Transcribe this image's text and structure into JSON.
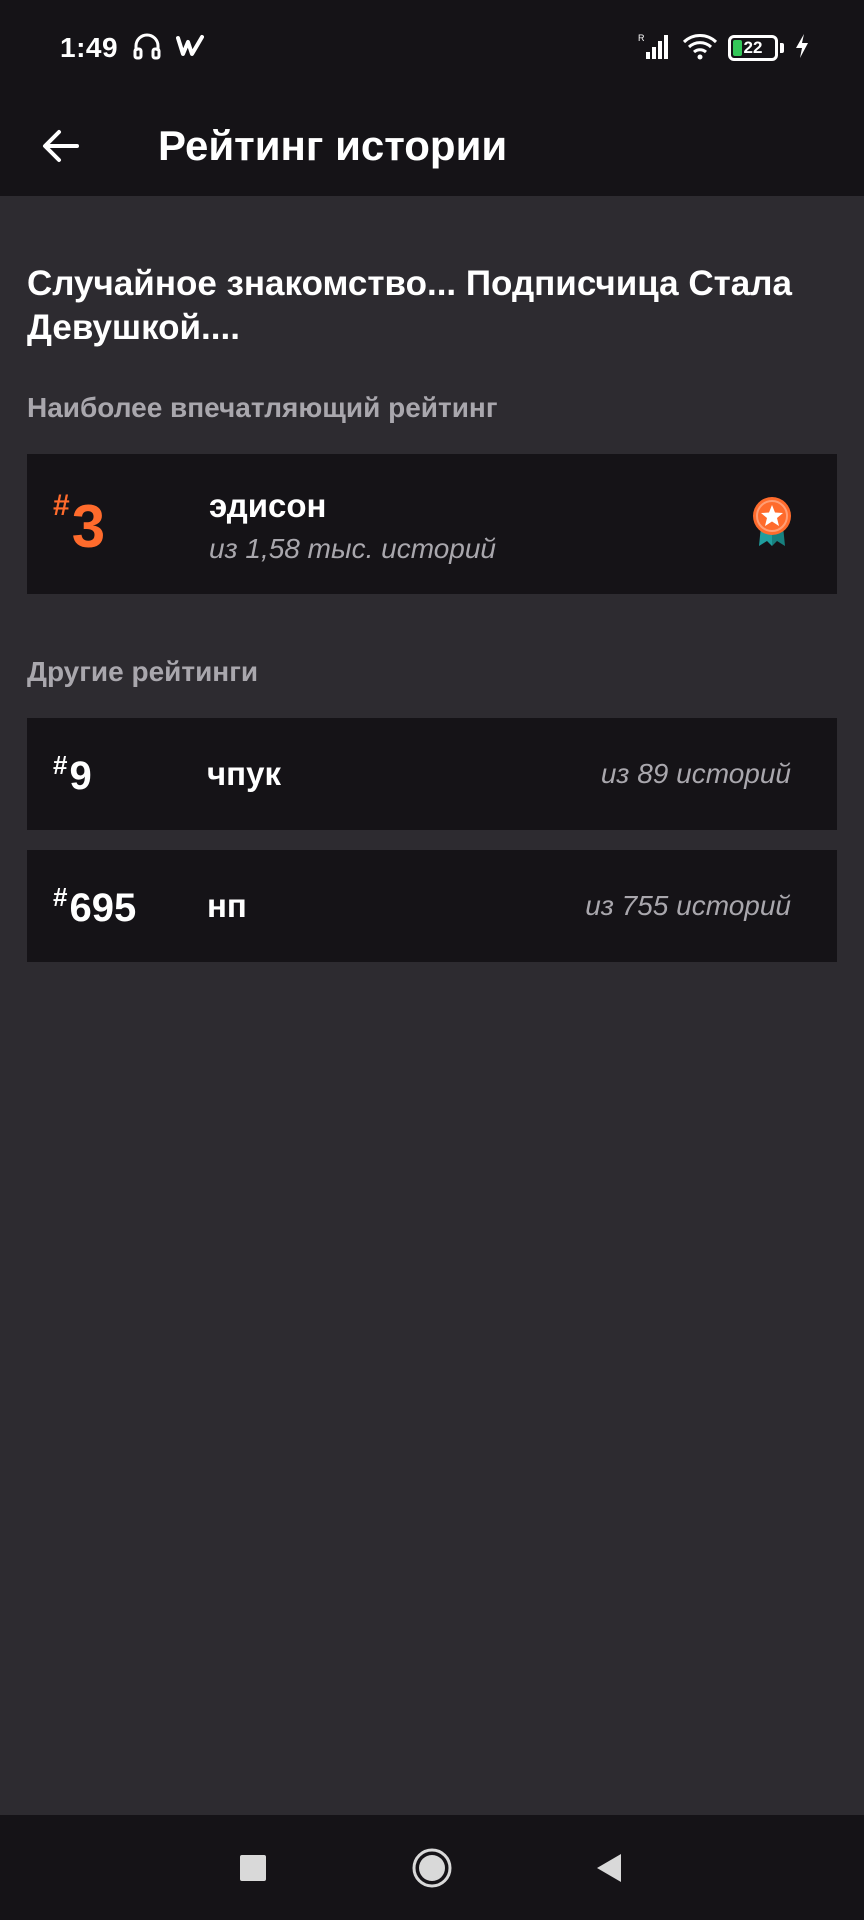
{
  "status_bar": {
    "time": "1:49",
    "battery_level": "22",
    "battery_fraction": 0.22,
    "icons": [
      "headphones-icon",
      "wattpad-logo-icon",
      "cellular-signal-icon",
      "wifi-icon",
      "battery-icon",
      "charging-bolt-icon"
    ]
  },
  "app_bar": {
    "title": "Рейтинг истории",
    "back_icon": "arrow-left-icon"
  },
  "story": {
    "title": "Случайное знакомство... Подписчица Стала Девушкой...."
  },
  "best_section": {
    "label": "Наиболее впечатляющий рейтинг",
    "card": {
      "hash": "#",
      "rank": "3",
      "tag": "эдисон",
      "subtitle": "из 1,58 тыс. историй",
      "badge_icon": "award-ribbon-icon"
    }
  },
  "other_section": {
    "label": "Другие рейтинги",
    "items": [
      {
        "hash": "#",
        "rank": "9",
        "tag": "чпук",
        "count": "из 89 историй"
      },
      {
        "hash": "#",
        "rank": "695",
        "tag": "нп",
        "count": "из 755 историй"
      }
    ]
  },
  "colors": {
    "background": "#2d2b30",
    "card": "#151317",
    "accent": "#ff6b2c",
    "badge_ribbon": "#1f9e9e",
    "secondary_text": "#a9a7ad"
  },
  "nav_bar": {
    "icons": [
      "recents-square-icon",
      "home-circle-icon",
      "back-triangle-icon"
    ]
  }
}
